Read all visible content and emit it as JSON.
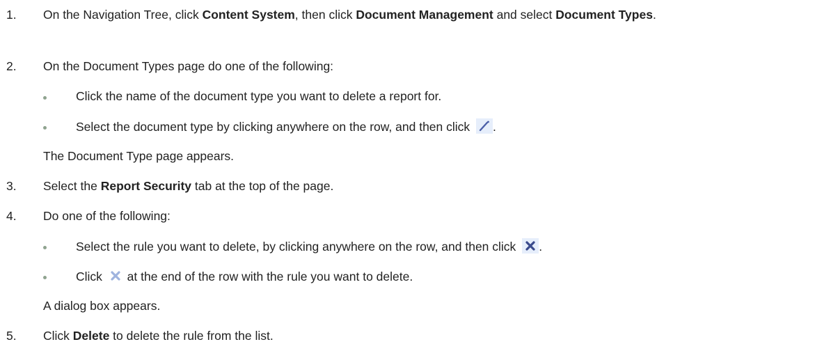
{
  "steps": [
    {
      "number": "1.",
      "parts": {
        "a": "On the Navigation Tree, click ",
        "b1": "Content System",
        "c": ", then click ",
        "b2": "Document Management",
        "d": " and select ",
        "b3": "Document Types",
        "e": "."
      }
    },
    {
      "number": "2.",
      "text": "On the Document Types page do one of the following:",
      "bullets": [
        "Click the name of the document type you want to delete a report for.",
        "Select the document type by clicking anywhere on the row, and then click"
      ],
      "bullet_end": ".",
      "note": "The Document Type page appears."
    },
    {
      "number": "3.",
      "parts": {
        "a": "Select the ",
        "b": "Report Security",
        "c": " tab at the top of the page."
      }
    },
    {
      "number": "4.",
      "text": "Do one of the following:",
      "bullets": [
        "Select the rule you want to delete, by clicking anywhere on the row, and then click",
        "Click",
        "at the end of the row with the rule you want to delete."
      ],
      "bullet_end": ".",
      "note": "A dialog box appears."
    },
    {
      "number": "5.",
      "parts": {
        "a": "Click ",
        "b": "Delete",
        "c": " to delete the rule from the list."
      }
    }
  ],
  "icons": {
    "edit": "pencil-edit-icon",
    "delete": "x-delete-icon"
  },
  "colors": {
    "bullet": "#8fa38f",
    "edit_icon_bg": "#e6eefb",
    "edit_icon": "#4b5fa8",
    "delete_icon": "#3a4a8c",
    "delete_icon_light": "#9fb3de"
  }
}
